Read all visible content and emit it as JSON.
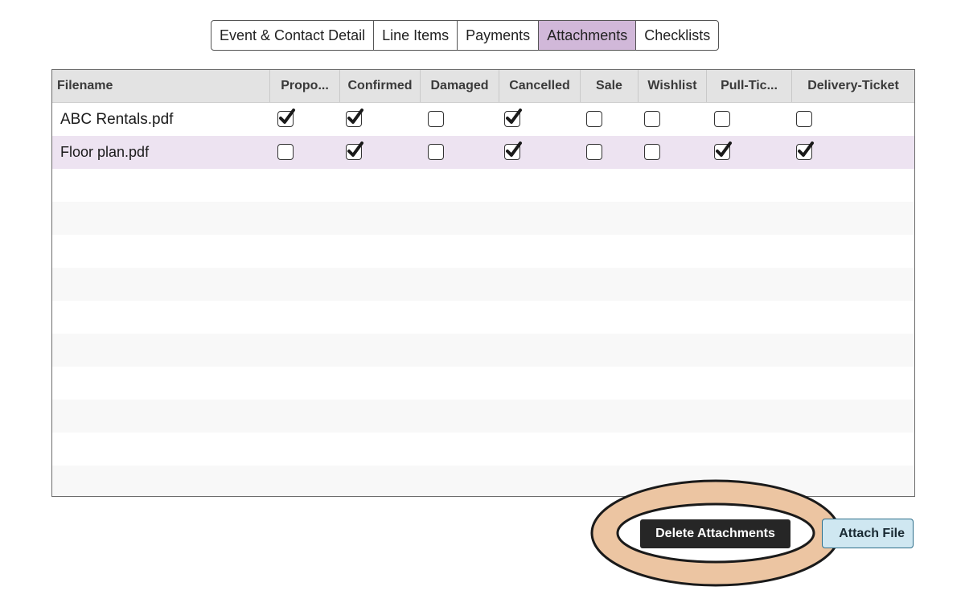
{
  "tabs": [
    {
      "label": "Event & Contact Detail"
    },
    {
      "label": "Line Items"
    },
    {
      "label": "Payments"
    },
    {
      "label": "Attachments",
      "active": true
    },
    {
      "label": "Checklists"
    }
  ],
  "grid": {
    "columns": [
      "Filename",
      "Propo...",
      "Confirmed",
      "Damaged",
      "Cancelled",
      "Sale",
      "Wishlist",
      "Pull-Tic...",
      "Delivery-Ticket"
    ],
    "rows": [
      {
        "filename": "ABC Rentals.pdf",
        "flags": [
          true,
          true,
          false,
          true,
          false,
          false,
          false,
          false
        ]
      },
      {
        "filename": "Floor plan.pdf",
        "flags": [
          false,
          true,
          false,
          true,
          false,
          false,
          true,
          true
        ],
        "selected": true
      }
    ]
  },
  "buttons": {
    "delete_label": "Delete Attachments",
    "attach_label": "Attach File"
  },
  "colors": {
    "active_tab": "#d1b8d9",
    "selected_row": "#ede3f1",
    "highlight_ring_fill": "#ecc5a2",
    "delete_button_bg": "#262626",
    "attach_button_bg": "#cfe7f1"
  }
}
